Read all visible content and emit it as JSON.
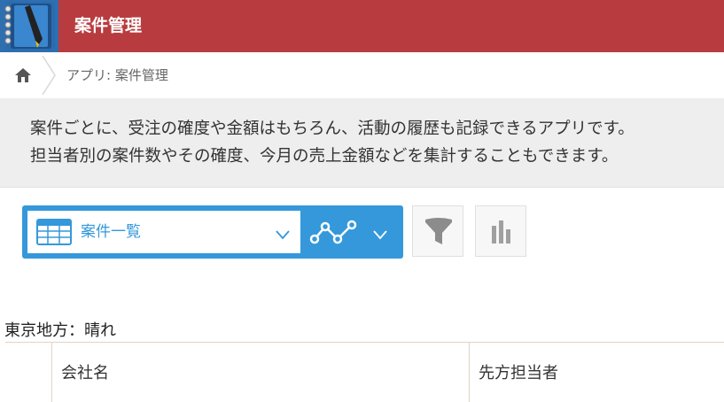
{
  "colors": {
    "header_bg": "#b83c3f",
    "accent_blue": "#3498db"
  },
  "header": {
    "title": "案件管理",
    "app_icon": "notebook-pen-icon"
  },
  "breadcrumb": {
    "home_icon": "home-icon",
    "text": "アプリ: 案件管理"
  },
  "description": {
    "line1": "案件ごとに、受注の確度や金額はもちろん、活動の履歴も記録できるアプリです。",
    "line2": "担当者別の案件数やその確度、今月の売上金額などを集計することもできます。"
  },
  "toolbar": {
    "view_selected": "案件一覧",
    "view_icon": "table-icon",
    "graph_icon": "line-graph-icon",
    "filter_icon": "funnel-icon",
    "chart_icon": "bar-chart-icon"
  },
  "weather": {
    "text": "東京地方：晴れ"
  },
  "table": {
    "columns": [
      "",
      "会社名",
      "先方担当者"
    ]
  }
}
